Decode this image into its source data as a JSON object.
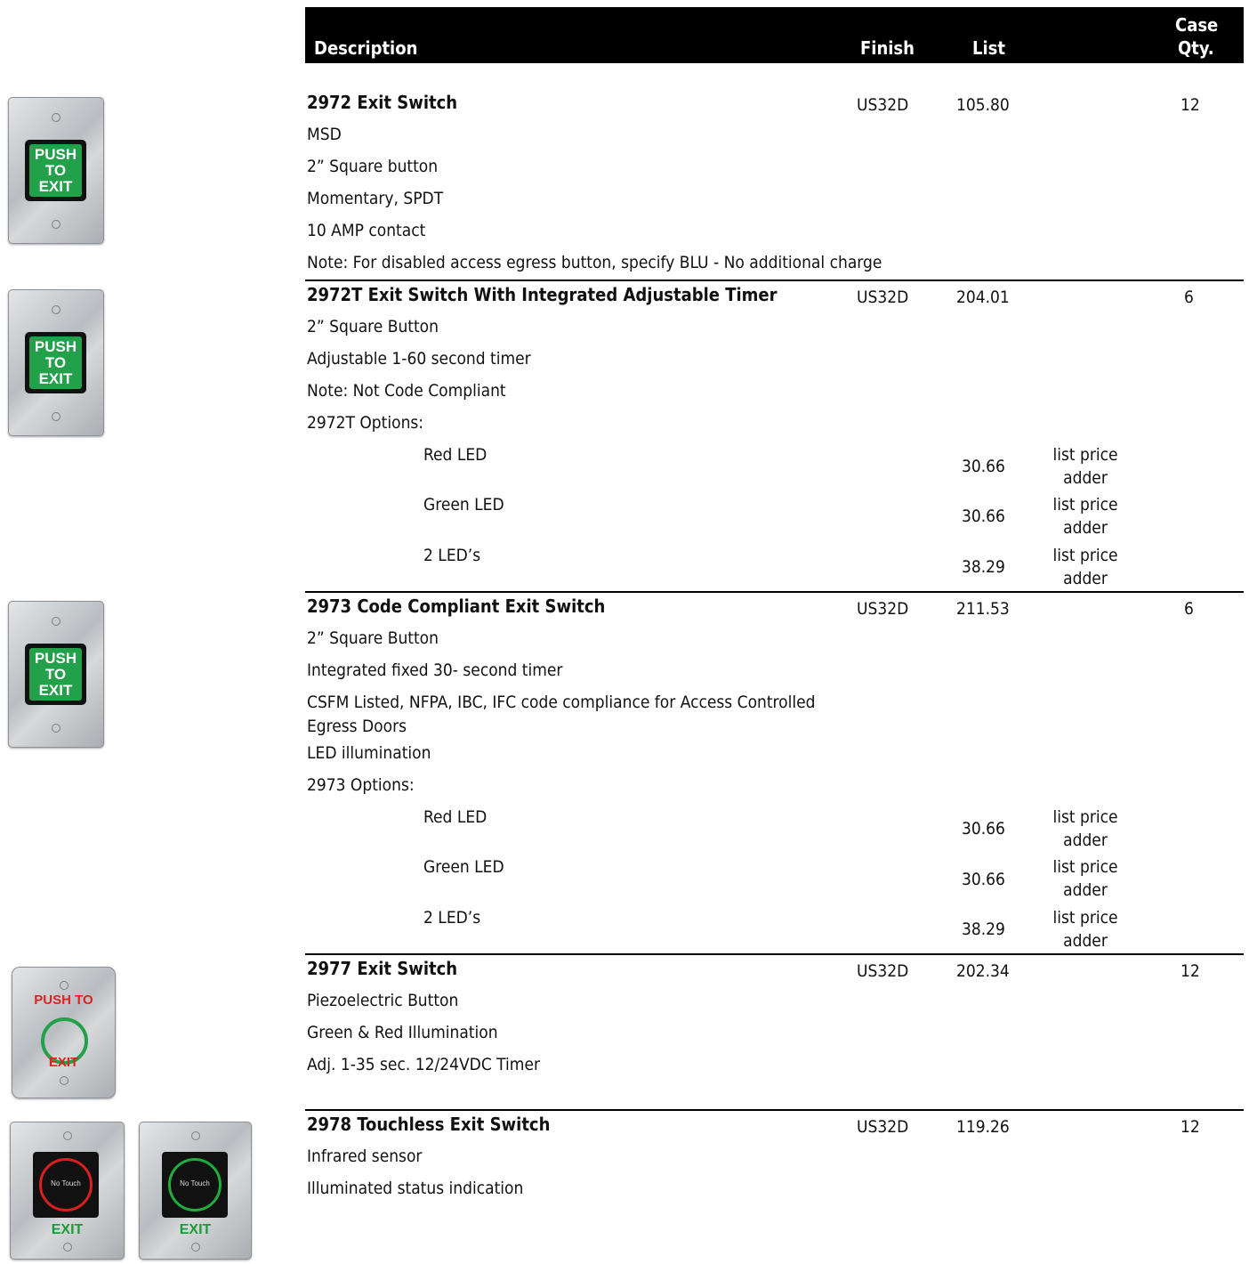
{
  "header": {
    "description": "Description",
    "finish": "Finish",
    "list": "List",
    "case_qty_line1": "Case",
    "case_qty_line2": "Qty."
  },
  "products": [
    {
      "title": "2972 Exit Switch",
      "finish": "US32D",
      "list": "105.80",
      "qty": "12",
      "lines": [
        "MSD",
        "2” Square button",
        "Momentary, SPDT",
        "10 AMP contact",
        "Note: For disabled access egress button, specify BLU - No additional charge"
      ]
    },
    {
      "title": "2972T Exit Switch With Integrated Adjustable Timer",
      "finish": "US32D",
      "list": "204.01",
      "qty": "6",
      "lines": [
        "2” Square Button",
        "Adjustable 1-60 second timer",
        "Note: Not Code Compliant",
        "2972T Options:"
      ],
      "options": [
        {
          "name": "Red LED",
          "price": "30.66",
          "note1": "list price",
          "note2": "adder"
        },
        {
          "name": "Green LED",
          "price": "30.66",
          "note1": "list price",
          "note2": "adder"
        },
        {
          "name": "2 LED’s",
          "price": "38.29",
          "note1": "list price",
          "note2": "adder"
        }
      ]
    },
    {
      "title": "2973 Code Compliant Exit Switch",
      "finish": "US32D",
      "list": "211.53",
      "qty": "6",
      "lines": [
        "2” Square Button",
        "Integrated fixed 30- second timer",
        "CSFM Listed, NFPA, IBC, IFC code compliance for Access Controlled",
        "Egress Doors",
        "LED illumination",
        "2973 Options:"
      ],
      "options": [
        {
          "name": "Red LED",
          "price": "30.66",
          "note1": "list price",
          "note2": "adder"
        },
        {
          "name": "Green LED",
          "price": "30.66",
          "note1": "list price",
          "note2": "adder"
        },
        {
          "name": "2 LED’s",
          "price": "38.29",
          "note1": "list price",
          "note2": "adder"
        }
      ]
    },
    {
      "title": "2977 Exit Switch",
      "finish": "US32D",
      "list": "202.34",
      "qty": "12",
      "lines": [
        "Piezoelectric Button",
        "Green & Red Illumination",
        "Adj. 1-35 sec. 12/24VDC Timer"
      ]
    },
    {
      "title": "2978 Touchless Exit Switch",
      "finish": "US32D",
      "list": "119.26",
      "qty": "12",
      "lines": [
        "Infrared sensor",
        "Illuminated status indication"
      ]
    }
  ],
  "images": {
    "push_to_exit": [
      "PUSH",
      "TO",
      "EXIT"
    ],
    "piezo_top": "PUSH TO",
    "piezo_bottom": "EXIT",
    "touch_label": "No Touch",
    "touch_exit": "EXIT",
    "colors": {
      "green_button": "#23a04a",
      "red_ring": "#d8201f",
      "green_ring": "#1fae3c",
      "piezo_text": "#dd2222"
    }
  }
}
